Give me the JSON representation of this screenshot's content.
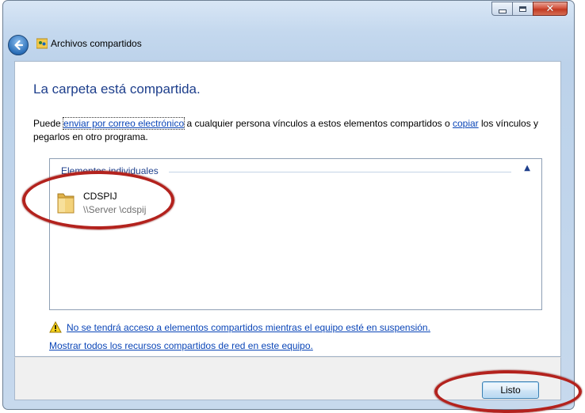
{
  "window": {
    "title": "Archivos compartidos",
    "controls": {
      "minimize_icon": "minimize-icon",
      "maximize_icon": "maximize-icon",
      "close_icon": "close-icon"
    }
  },
  "content": {
    "heading": "La carpeta está compartida.",
    "description": {
      "text_before": "Puede ",
      "email_link": "enviar por correo electrónico",
      "text_middle": " a cualquier persona vínculos a estos elementos compartidos o ",
      "copy_link": "copiar",
      "text_after": " los vínculos y pegarlos en otro programa."
    },
    "shared_items": {
      "group_header": "Elementos individuales",
      "items": [
        {
          "name": "CDSPIJ",
          "path": "\\\\Server \\cdspij",
          "icon": "folder-icon"
        }
      ]
    },
    "warning": {
      "icon": "warning-icon",
      "text": "No se tendrá acceso a elementos compartidos mientras el equipo esté en suspensión."
    },
    "show_all_link": "Mostrar todos los recursos compartidos de red en este equipo."
  },
  "footer": {
    "done_label": "Listo"
  },
  "colors": {
    "heading": "#1e3f8c",
    "link": "#0b46b8",
    "annotation": "#b3221d"
  }
}
